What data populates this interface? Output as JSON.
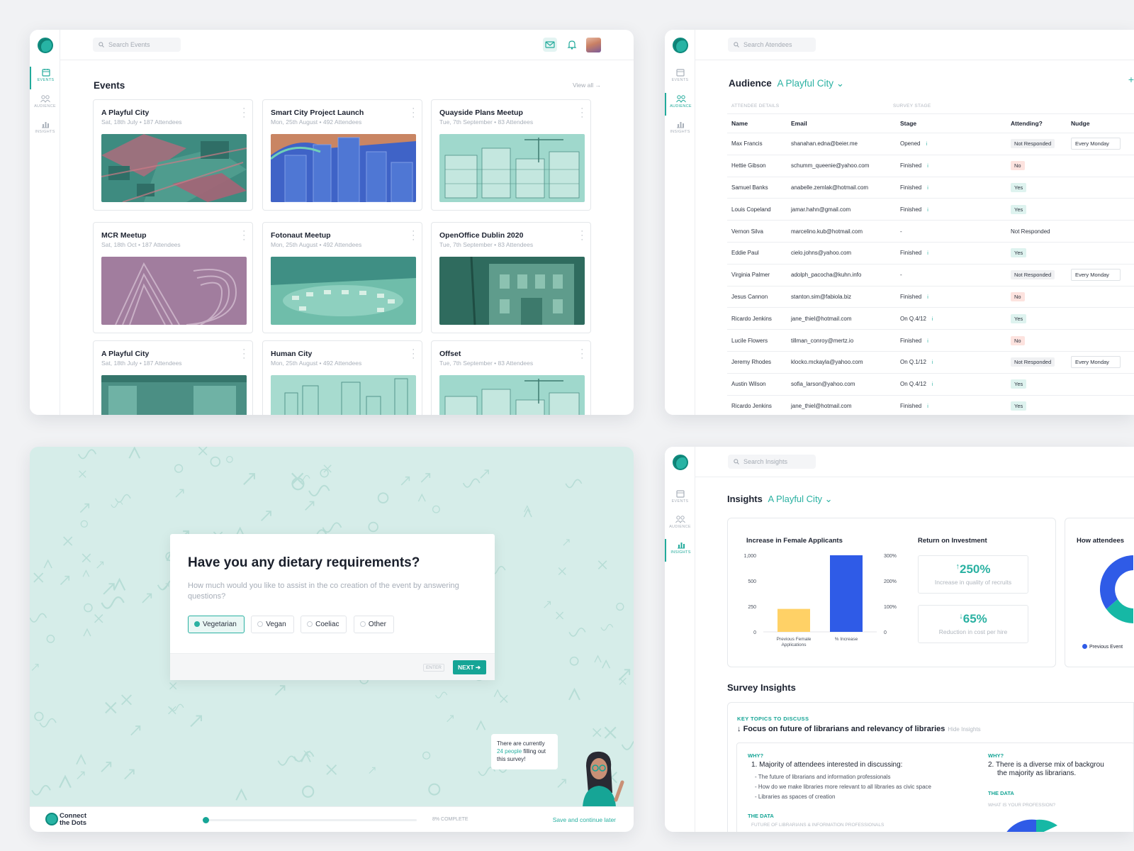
{
  "nav": {
    "events": "EVENTS",
    "audience": "AUDIENCE",
    "insights": "INSIGHTS"
  },
  "colors": {
    "accent": "#22aa9b",
    "bar_previous": "#ffd166",
    "bar_increase": "#2f5be7",
    "donut_blue": "#2f5be7",
    "donut_teal": "#16b8a5"
  },
  "events_panel": {
    "search_placeholder": "Search Events",
    "title": "Events",
    "view_all": "View all →",
    "cards": [
      {
        "title": "A Playful City",
        "meta": "Sat, 18th July  •  187 Attendees"
      },
      {
        "title": "Smart City Project Launch",
        "meta": "Mon, 25th August  •  492 Attendees"
      },
      {
        "title": "Quayside Plans Meetup",
        "meta": "Tue, 7th September  •  83 Attendees"
      },
      {
        "title": "MCR Meetup",
        "meta": "Sat, 18th Oct  •  187 Attendees"
      },
      {
        "title": "Fotonaut Meetup",
        "meta": "Mon, 25th August  •  492 Attendees"
      },
      {
        "title": "OpenOffice Dublin 2020",
        "meta": "Tue, 7th September  •  83 Attendees"
      },
      {
        "title": "A Playful City",
        "meta": "Sat, 18th July  •  187 Attendees"
      },
      {
        "title": "Human City",
        "meta": "Mon, 25th August  •  492 Attendees"
      },
      {
        "title": "Offset",
        "meta": "Tue, 7th September  •  83 Attendees"
      }
    ]
  },
  "audience_panel": {
    "search_placeholder": "Search Atendees",
    "title": "Audience",
    "city": "A Playful City ⌄",
    "plus": "+",
    "group_attendee": "ATTENDEE DETAILS",
    "group_survey": "SURVEY STAGE",
    "columns": [
      "Name",
      "Email",
      "Stage",
      "Attending?",
      "Nudge"
    ],
    "rows": [
      {
        "name": "Max Francis",
        "email": "shanahan.edna@beier.me",
        "stage": "Opened",
        "info": "i",
        "attending": "Not Responded",
        "att_kind": "nr",
        "nudge": "Every Monday"
      },
      {
        "name": "Hettie Gibson",
        "email": "schumm_queenie@yahoo.com",
        "stage": "Finished",
        "info": "i",
        "attending": "No",
        "att_kind": "no",
        "nudge": ""
      },
      {
        "name": "Samuel Banks",
        "email": "anabelle.zemlak@hotmail.com",
        "stage": "Finished",
        "info": "i",
        "attending": "Yes",
        "att_kind": "yes",
        "nudge": ""
      },
      {
        "name": "Louis Copeland",
        "email": "jamar.hahn@gmail.com",
        "stage": "Finished",
        "info": "i",
        "attending": "Yes",
        "att_kind": "yes",
        "nudge": ""
      },
      {
        "name": "Vernon Silva",
        "email": "marcelino.kub@hotmail.com",
        "stage": "-",
        "info": "",
        "attending": "Not Responded",
        "att_kind": "plain",
        "nudge": ""
      },
      {
        "name": "Eddie Paul",
        "email": "cielo.johns@yahoo.com",
        "stage": "Finished",
        "info": "i",
        "attending": "Yes",
        "att_kind": "yes",
        "nudge": ""
      },
      {
        "name": "Virginia Palmer",
        "email": "adolph_pacocha@kuhn.info",
        "stage": "-",
        "info": "",
        "attending": "Not Responded",
        "att_kind": "nr",
        "nudge": "Every Monday"
      },
      {
        "name": "Jesus Cannon",
        "email": "stanton.sim@fabiola.biz",
        "stage": "Finished",
        "info": "i",
        "attending": "No",
        "att_kind": "no",
        "nudge": ""
      },
      {
        "name": "Ricardo Jenkins",
        "email": "jane_thiel@hotmail.com",
        "stage": "On Q.4/12",
        "info": "i",
        "attending": "Yes",
        "att_kind": "yes",
        "nudge": ""
      },
      {
        "name": "Lucile Flowers",
        "email": "tillman_conroy@mertz.io",
        "stage": "Finished",
        "info": "i",
        "attending": "No",
        "att_kind": "no",
        "nudge": ""
      },
      {
        "name": "Jeremy Rhodes",
        "email": "klocko.mckayla@yahoo.com",
        "stage": "On Q.1/12",
        "info": "i",
        "attending": "Not Responded",
        "att_kind": "nr",
        "nudge": "Every Monday"
      },
      {
        "name": "Austin Wilson",
        "email": "sofia_larson@yahoo.com",
        "stage": "On Q.4/12",
        "info": "i",
        "attending": "Yes",
        "att_kind": "yes",
        "nudge": ""
      },
      {
        "name": "Ricardo Jenkins",
        "email": "jane_thiel@hotmail.com",
        "stage": "Finished",
        "info": "i",
        "attending": "Yes",
        "att_kind": "yes",
        "nudge": ""
      }
    ]
  },
  "survey_panel": {
    "question": "Have you any dietary requirements?",
    "subtitle": "How much would you like to assist in the co creation of the event by answering questions?",
    "options": [
      "Vegetarian",
      "Vegan",
      "Coeliac",
      "Other"
    ],
    "selected_option": "Vegetarian",
    "enter_hint": "ENTER",
    "next_label": "NEXT",
    "bubble_prefix": "There are currently ",
    "bubble_count": "24 people",
    "bubble_suffix": " filling out this survey!",
    "brand_line1": "Connect",
    "brand_line2": "the Dots",
    "progress_label": "8% COMPLETE",
    "progress_fraction": 0.08,
    "save_label": "Save and continue later"
  },
  "insights_panel": {
    "search_placeholder": "Search Insights",
    "title": "Insights",
    "city": "A Playful City ⌄",
    "card1_title": "Increase in Female Applicants",
    "card2_title": "Return on Investment",
    "card3_title": "How attendees",
    "roi": [
      {
        "value": "250%",
        "arrow": "↑",
        "label": "Increase in quality of recruits"
      },
      {
        "value": "65%",
        "arrow": "↓",
        "label": "Reduction in cost per hire"
      }
    ],
    "donut_legend": "Previous Event",
    "survey_title": "Survey Insights",
    "key_topics": "KEY TOPICS TO DISCUSS",
    "focus": "Focus on future of librarians and relevancy of libraries",
    "hide": "Hide Insights",
    "why": "WHY?",
    "point1": "1. Majority of attendees interested in discussing:",
    "bullets": [
      "- The future of librarians and information professionals",
      "- How do we make libraries more relevant to all libraries as civic space",
      "- Libraries as spaces of creation"
    ],
    "the_data": "THE DATA",
    "data_caption1": "FUTURE OF LIBRARIANS & INFORMATION PROFESSIONALS",
    "point2_line1": "2. There is a diverse mix of backgrou",
    "point2_line2": "the  majority as librarians.",
    "data_caption2": "WHAT IS YOUR PROFESSION?"
  },
  "chart_data": {
    "type": "bar",
    "title": "Increase in Female Applicants",
    "categories": [
      "Previous Female Applications",
      "% Increase"
    ],
    "category_labels": [
      "Previous Female\nApplications",
      "% Increase"
    ],
    "values": [
      300,
      1000
    ],
    "ylim": [
      0,
      1000
    ],
    "left_ticks": [
      "1,000",
      "500",
      "250",
      "0"
    ],
    "right_ticks": [
      "300%",
      "200%",
      "100%",
      "0"
    ],
    "grid": false
  }
}
